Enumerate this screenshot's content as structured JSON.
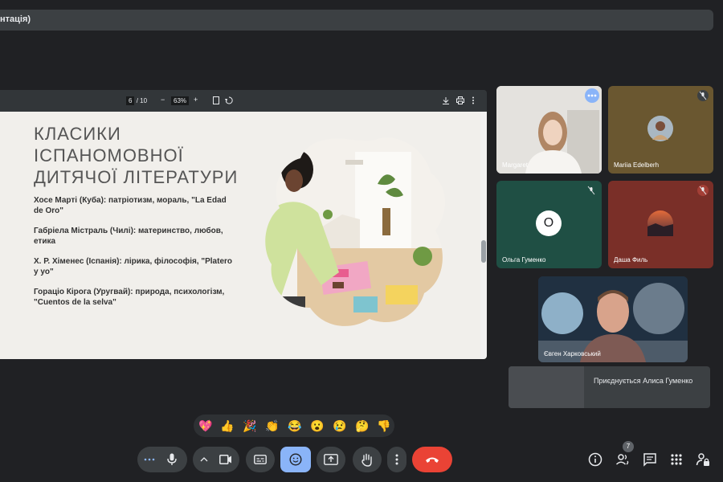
{
  "presenting": {
    "title": "нтація)"
  },
  "pdf_toolbar": {
    "page_current": "6",
    "page_total": "/ 10",
    "zoom": "63%"
  },
  "slide": {
    "title_lines": [
      "КЛАСИКИ",
      "ІСПАНОМОВНОЇ",
      "ДИТЯЧОЇ ЛІТЕРАТУРИ"
    ],
    "items": [
      "Хосе Марті (Куба): патріотизм, мораль, \"La Edad de Oro\"",
      "Габріела Містраль (Чилі): материнство, любов, етика",
      "Х. Р. Хіменес (Іспанія): лірика, філософія, \"Platero y yo\"",
      "Гораціо Кірога (Уругвай): природа, психологізм, \"Cuentos de la selva\""
    ]
  },
  "participants": [
    {
      "name": "Margaret"
    },
    {
      "name": "Mariia Edelberh"
    },
    {
      "name": "Ольга Гуменко",
      "initial": "О"
    },
    {
      "name": "Даша Филь"
    },
    {
      "name": "Євген Харковський"
    }
  ],
  "join_notice": {
    "text": "Приєднується Алиса Гуменко"
  },
  "reactions": [
    "💖",
    "👍",
    "🎉",
    "👏",
    "😂",
    "😮",
    "😢",
    "🤔",
    "👎"
  ],
  "people_count": "7",
  "colors": {
    "leave_red": "#ea4335",
    "active_blue": "#8ab4f8",
    "bar_bg": "#3c4043"
  },
  "icons": [
    "more-dots-icon",
    "mic-icon",
    "chevron-up-icon",
    "camera-icon",
    "captions-icon",
    "emoji-icon",
    "present-icon",
    "raise-hand-icon",
    "more-vert-icon",
    "hang-up-icon",
    "info-icon",
    "people-icon",
    "chat-icon",
    "apps-icon",
    "lock-person-icon"
  ]
}
